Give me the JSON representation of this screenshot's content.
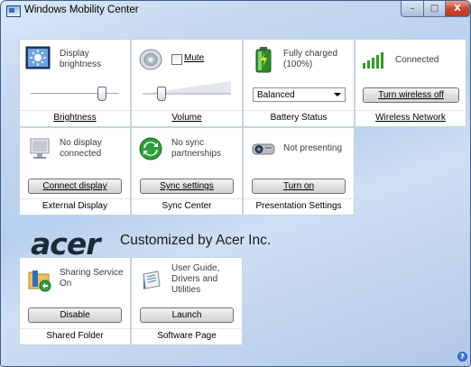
{
  "window": {
    "title": "Windows Mobility Center",
    "controls": {
      "minimize": "–",
      "maximize": "□",
      "close": "X"
    }
  },
  "tiles": {
    "brightness": {
      "info": [
        "Display",
        "brightness"
      ],
      "label": "Brightness",
      "level": 0.78
    },
    "volume": {
      "mute_label": "Mute",
      "label": "Volume",
      "level": 0.1
    },
    "battery": {
      "info": [
        "Fully charged",
        "(100%)"
      ],
      "plan": "Balanced",
      "label": "Battery Status"
    },
    "wireless": {
      "info": "Connected",
      "button": "Turn wireless off",
      "label": "Wireless Network"
    },
    "external_display": {
      "info": [
        "No display",
        "connected"
      ],
      "button": "Connect display",
      "label": "External Display"
    },
    "sync": {
      "info": [
        "No sync",
        "partnerships"
      ],
      "button": "Sync settings",
      "label": "Sync Center"
    },
    "presentation": {
      "info": "Not presenting",
      "button": "Turn on",
      "label": "Presentation Settings"
    },
    "shared_folder": {
      "info": [
        "Sharing Service",
        "On"
      ],
      "button": "Disable",
      "label": "Shared Folder"
    },
    "software": {
      "info": [
        "User Guide,",
        "Drivers and",
        "Utilities"
      ],
      "button": "Launch",
      "label": "Software Page"
    }
  },
  "branding": {
    "logo": "acer",
    "text": "Customized by Acer Inc."
  },
  "help": "?"
}
